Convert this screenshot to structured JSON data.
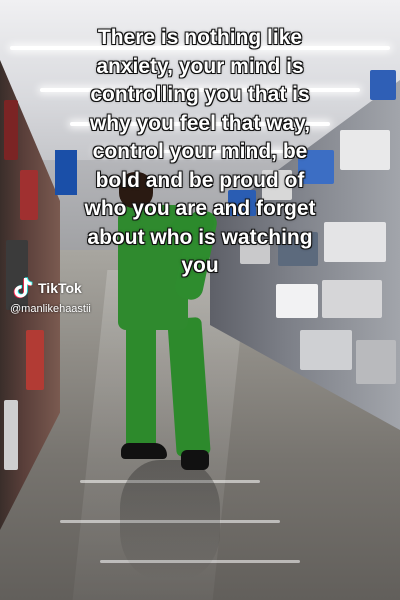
{
  "caption": {
    "lines": [
      "There is nothing like",
      "anxiety, your mind is",
      "controlling you that is",
      "why you feel that way,",
      "control your mind, be",
      "bold and be proud of",
      "who you are and forget",
      "about who is watching",
      "you"
    ],
    "color": "#ffffff"
  },
  "watermark": {
    "brand": "TikTok",
    "handle": "@manlikehaastii",
    "icon": "tiktok-logo-icon"
  },
  "scene": {
    "subject_outfit_color": "#2e8c2e"
  }
}
